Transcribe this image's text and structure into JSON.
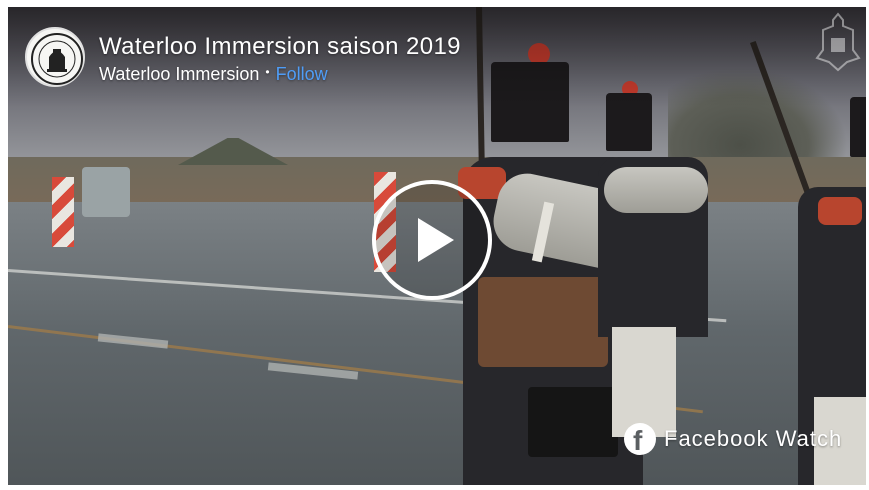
{
  "video": {
    "title": "Waterloo Immersion saison 2019",
    "page_name": "Waterloo Immersion",
    "separator": "•",
    "follow_label": "Follow",
    "branding_label": "Facebook Watch",
    "fb_glyph": "f"
  },
  "icons": {
    "avatar": "waterloo-logo-icon",
    "crest": "crest-watermark-icon",
    "play": "play-icon",
    "facebook": "facebook-icon"
  },
  "colors": {
    "follow_link": "#4f9df7",
    "text": "#ffffff",
    "play_ring": "#ffffff"
  }
}
